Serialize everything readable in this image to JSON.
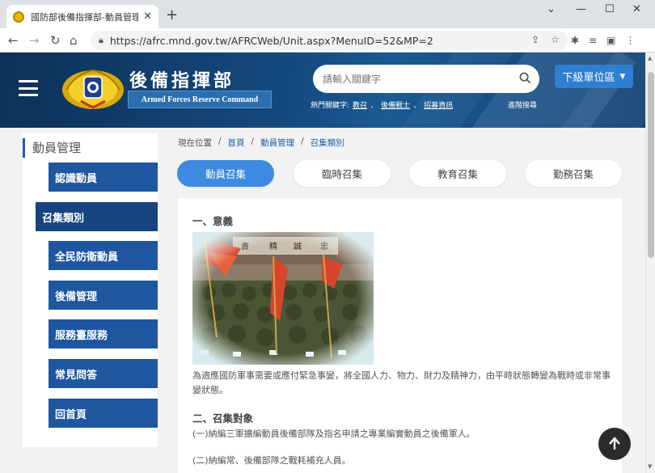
{
  "browser": {
    "tab_title": "國防部後備指揮部-動員管理-動員...",
    "new_tab": "+",
    "url": "https://afrc.mnd.gov.tw/AFRCWeb/Unit.aspx?MenuID=52&MP=2"
  },
  "header": {
    "title": "後備指揮部",
    "subtitle": "Armed Forces Reserve Command",
    "search_placeholder": "請輸入關鍵字",
    "hot_label": "熱門關鍵字:",
    "hot_keywords": [
      "教召",
      "後備戰士",
      "招募資訊"
    ],
    "advanced_search": "進階搜尋",
    "unit_button": "下級單位區"
  },
  "sidebar": {
    "heading": "動員管理",
    "items": [
      {
        "label": "認識動員"
      },
      {
        "label": "召集類別"
      },
      {
        "label": "全民防衛動員"
      },
      {
        "label": "後備管理"
      },
      {
        "label": "服務臺服務"
      },
      {
        "label": "常見問答"
      },
      {
        "label": "回首頁"
      }
    ]
  },
  "breadcrumb": {
    "prefix": "現在位置",
    "items": [
      "首頁",
      "動員管理",
      "召集類別"
    ]
  },
  "tabs": [
    "動員召集",
    "臨時召集",
    "教育召集",
    "勤務召集"
  ],
  "content": {
    "h1": "一、意義",
    "p1": "為適應國防軍事需要或應付緊急事變，將全國人力、物力、財力及精神力，由平時狀態轉變為戰時或非常事變狀態。",
    "h2": "二、召集對象",
    "p2": "(一)納編三軍擴編動員後備部隊及指名申請之專業編實動員之後備軍人。",
    "p3": "(二)納編常、後備部隊之戰耗補充人員。"
  },
  "colors": {
    "header_bg": "#154a7f",
    "sidebar_item": "#1e56a0",
    "active_pill": "#3e8ae0"
  }
}
